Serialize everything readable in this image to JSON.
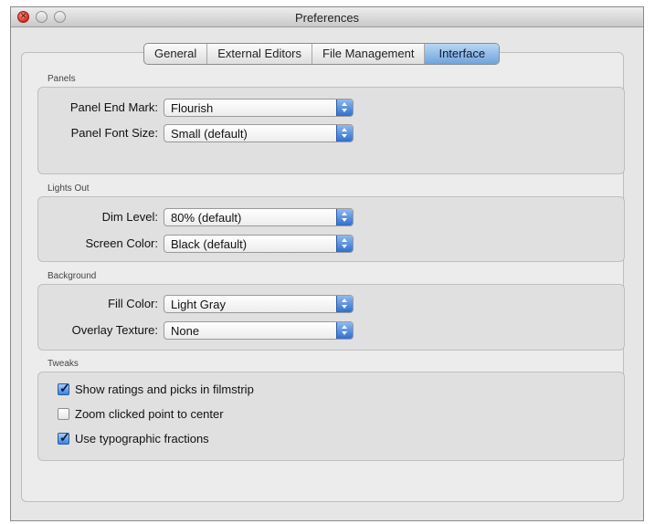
{
  "window": {
    "title": "Preferences"
  },
  "tabs": [
    {
      "label": "General",
      "selected": false
    },
    {
      "label": "External Editors",
      "selected": false
    },
    {
      "label": "File Management",
      "selected": false
    },
    {
      "label": "Interface",
      "selected": true
    }
  ],
  "panels": {
    "label": "Panels",
    "end_mark": {
      "label": "Panel End Mark:",
      "value": "Flourish"
    },
    "font_size": {
      "label": "Panel Font Size:",
      "value": "Small (default)"
    }
  },
  "lights_out": {
    "label": "Lights Out",
    "dim_level": {
      "label": "Dim Level:",
      "value": "80% (default)"
    },
    "screen_color": {
      "label": "Screen Color:",
      "value": "Black (default)"
    }
  },
  "background": {
    "label": "Background",
    "fill_color": {
      "label": "Fill Color:",
      "value": "Light Gray"
    },
    "overlay_texture": {
      "label": "Overlay Texture:",
      "value": "None"
    }
  },
  "tweaks": {
    "label": "Tweaks",
    "items": [
      {
        "label": "Show ratings and picks in filmstrip",
        "checked": true
      },
      {
        "label": "Zoom clicked point to center",
        "checked": false
      },
      {
        "label": "Use typographic fractions",
        "checked": true
      }
    ]
  },
  "colors": {
    "accent": "#3d82dc",
    "window_bg": "#e6e6e6",
    "close_red": "#d2281e"
  }
}
